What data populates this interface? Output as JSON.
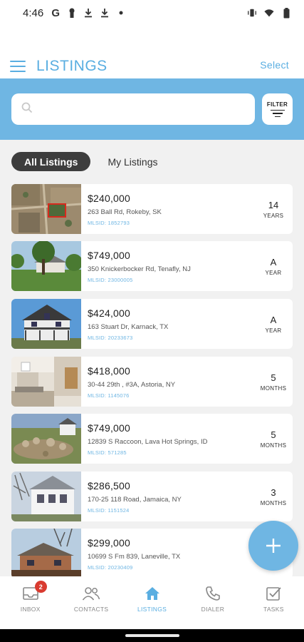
{
  "status_bar": {
    "time": "4:46",
    "left_icons": [
      "google-icon",
      "keyhole-icon",
      "download-icon",
      "download-icon",
      "dot-icon"
    ],
    "right_icons": [
      "vibrate-icon",
      "wifi-icon",
      "battery-icon"
    ]
  },
  "header": {
    "title": "LISTINGS",
    "select_label": "Select",
    "menu_icon": "hamburger-menu-icon"
  },
  "search": {
    "placeholder": "",
    "value": "",
    "filter_label": "FILTER"
  },
  "tabs": [
    {
      "label": "All Listings",
      "active": true
    },
    {
      "label": "My Listings",
      "active": false
    }
  ],
  "listings": [
    {
      "price": "$240,000",
      "address": "263 Ball Rd, Rokeby, SK",
      "mlsid": "MLSID: 1852793",
      "age_num": "14",
      "age_unit": "YEARS"
    },
    {
      "price": "$749,000",
      "address": "350 Knickerbocker Rd, Tenafly, NJ",
      "mlsid": "MLSID: 23000005",
      "age_num": "A",
      "age_unit": "YEAR"
    },
    {
      "price": "$424,000",
      "address": "163 Stuart Dr, Karnack, TX",
      "mlsid": "MLSID: 20233673",
      "age_num": "A",
      "age_unit": "YEAR"
    },
    {
      "price": "$418,000",
      "address": "30-44 29th , #3A, Astoria, NY",
      "mlsid": "MLSID: 1145076",
      "age_num": "5",
      "age_unit": "MONTHS"
    },
    {
      "price": "$749,000",
      "address": "12839 S Raccoon, Lava Hot Springs, ID",
      "mlsid": "MLSID: 571285",
      "age_num": "5",
      "age_unit": "MONTHS"
    },
    {
      "price": "$286,500",
      "address": "170-25 118 Road, Jamaica, NY",
      "mlsid": "MLSID: 1151524",
      "age_num": "3",
      "age_unit": "MONTHS"
    },
    {
      "price": "$299,000",
      "address": "10699 S Fm 839, Laneville, TX",
      "mlsid": "MLSID: 20230409",
      "age_num": "",
      "age_unit": ""
    }
  ],
  "bottom_nav": [
    {
      "label": "INBOX",
      "icon": "inbox-icon",
      "badge": "2",
      "active": false
    },
    {
      "label": "CONTACTS",
      "icon": "contacts-icon",
      "badge": "",
      "active": false
    },
    {
      "label": "LISTINGS",
      "icon": "home-icon",
      "badge": "",
      "active": true
    },
    {
      "label": "DIALER",
      "icon": "phone-icon",
      "badge": "",
      "active": false
    },
    {
      "label": "TASKS",
      "icon": "checkbox-icon",
      "badge": "",
      "active": false
    }
  ],
  "colors": {
    "accent": "#5aaee1",
    "search_band": "#6fb6e3",
    "active_tab": "#3d3d3d",
    "badge": "#d93b30"
  }
}
